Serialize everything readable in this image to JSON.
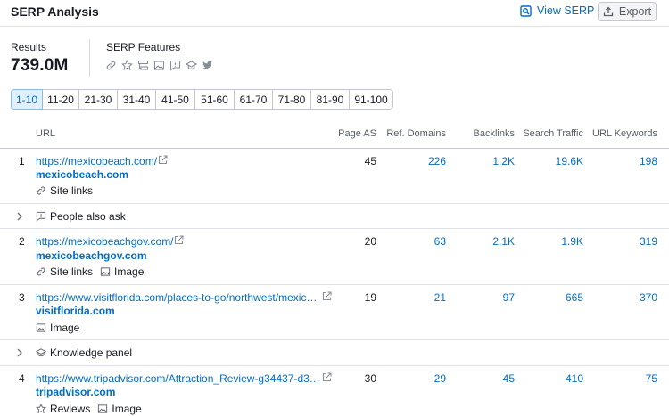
{
  "header": {
    "title": "SERP Analysis",
    "view_serp": "View SERP",
    "export": "Export"
  },
  "summary": {
    "results_label": "Results",
    "results_value": "739.0M",
    "features_label": "SERP Features",
    "feature_icons": [
      "link-icon",
      "star-icon",
      "site-links-icon",
      "image-icon",
      "people-also-ask-icon",
      "knowledge-panel-icon",
      "twitter-icon"
    ]
  },
  "pager": [
    "1-10",
    "11-20",
    "21-30",
    "31-40",
    "41-50",
    "51-60",
    "61-70",
    "71-80",
    "81-90",
    "91-100"
  ],
  "pager_active": "1-10",
  "columns": {
    "url": "URL",
    "page_as": "Page AS",
    "ref_domains": "Ref. Domains",
    "backlinks": "Backlinks",
    "search_traffic": "Search Traffic",
    "url_keywords": "URL Keywords"
  },
  "rows": [
    {
      "rank": "1",
      "url": "https://mexicobeach.com/",
      "domain": "mexicobeach.com",
      "tags": [
        "Site links"
      ],
      "page_as": "45",
      "ref_domains": "226",
      "backlinks": "1.2K",
      "search_traffic": "19.6K",
      "url_keywords": "198"
    },
    {
      "rank": "2",
      "url": "https://mexicobeachgov.com/",
      "domain": "mexicobeachgov.com",
      "tags": [
        "Site links",
        "Image"
      ],
      "page_as": "20",
      "ref_domains": "63",
      "backlinks": "2.1K",
      "search_traffic": "1.9K",
      "url_keywords": "319"
    },
    {
      "rank": "3",
      "url": "https://www.visitflorida.com/places-to-go/northwest/mexic…",
      "domain": "visitflorida.com",
      "tags": [
        "Image"
      ],
      "page_as": "19",
      "ref_domains": "21",
      "backlinks": "97",
      "search_traffic": "665",
      "url_keywords": "370"
    },
    {
      "rank": "4",
      "url": "https://www.tripadvisor.com/Attraction_Review-g34437-d3…",
      "domain": "tripadvisor.com",
      "tags": [
        "Reviews",
        "Image"
      ],
      "page_as": "30",
      "ref_domains": "29",
      "backlinks": "45",
      "search_traffic": "410",
      "url_keywords": "75"
    }
  ],
  "expand_rows": {
    "people_also_ask": "People also ask",
    "knowledge_panel": "Knowledge panel"
  },
  "colors": {
    "link": "#006dca",
    "active_page_bg": "#e1f0ff",
    "text": "#171a22",
    "muted": "#575c66"
  }
}
